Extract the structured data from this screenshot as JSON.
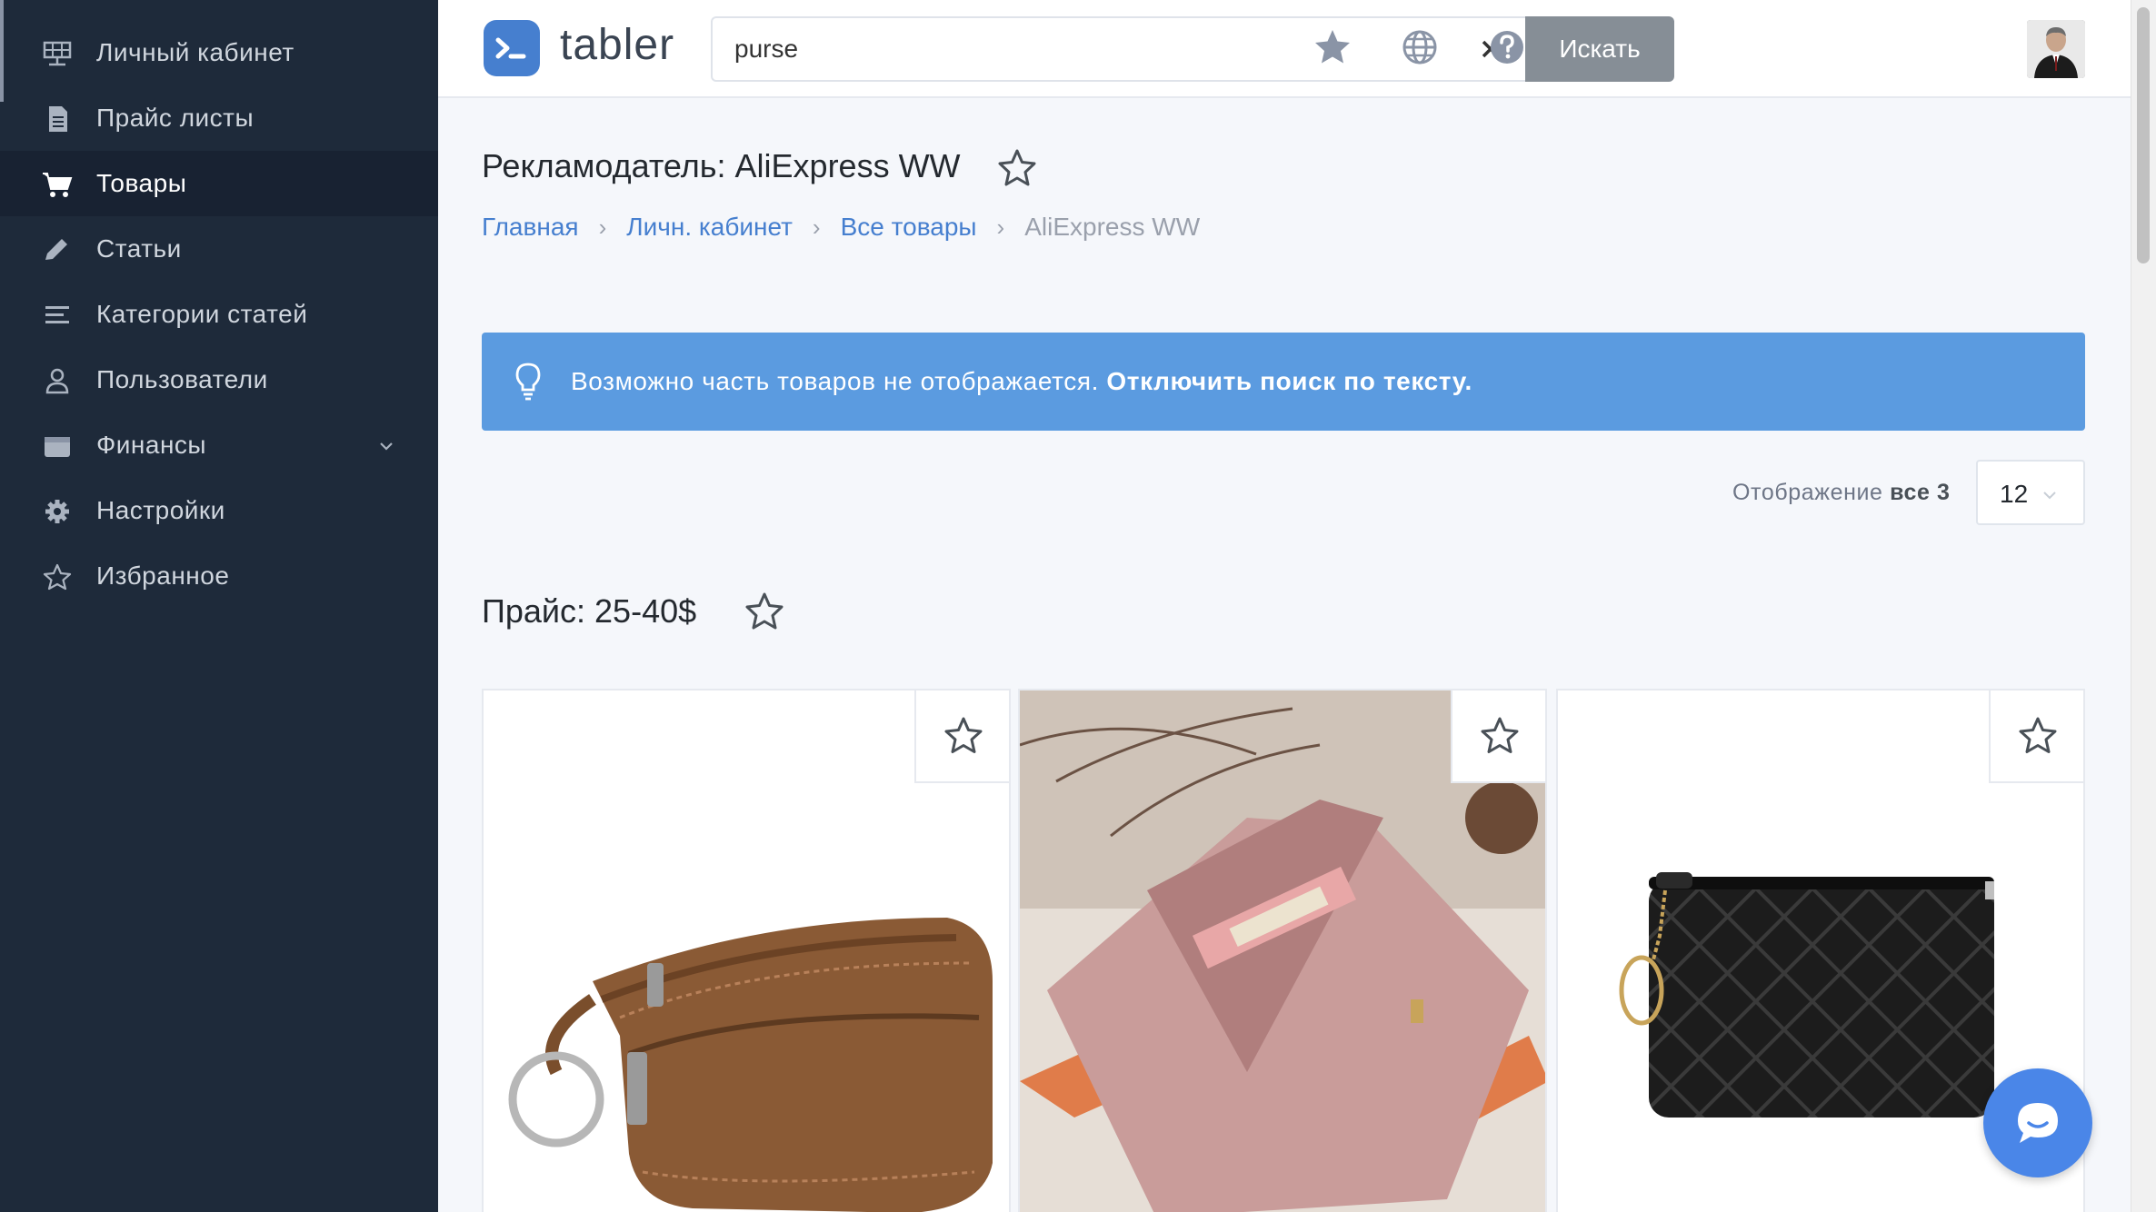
{
  "sidebar": {
    "items": [
      {
        "label": "Личный кабинет",
        "icon": "dashboard-icon",
        "active": false
      },
      {
        "label": "Прайс листы",
        "icon": "document-icon",
        "active": false
      },
      {
        "label": "Товары",
        "icon": "cart-icon",
        "active": true
      },
      {
        "label": "Статьи",
        "icon": "pencil-icon",
        "active": false
      },
      {
        "label": "Категории статей",
        "icon": "list-icon",
        "active": false
      },
      {
        "label": "Пользователи",
        "icon": "user-icon",
        "active": false
      },
      {
        "label": "Финансы",
        "icon": "wallet-icon",
        "active": false,
        "expandable": true
      },
      {
        "label": "Настройки",
        "icon": "gear-icon",
        "active": false
      },
      {
        "label": "Избранное",
        "icon": "star-icon",
        "active": false
      }
    ]
  },
  "header": {
    "logo_text": "tabler",
    "search_value": "purse",
    "search_button": "Искать",
    "icons": [
      "star-icon",
      "globe-icon",
      "help-icon",
      "avatar"
    ]
  },
  "page": {
    "title": "Рекламодатель: AliExpress WW",
    "breadcrumb": [
      "Главная",
      "Личн. кабинет",
      "Все товары",
      "AliExpress WW"
    ]
  },
  "alert": {
    "text": "Возможно часть товаров не отображается.",
    "link": "Отключить поиск по тексту."
  },
  "listing": {
    "display_prefix": "Отображение",
    "display_bold": "все 3",
    "per_page": "12"
  },
  "section": {
    "title": "Прайс: 25-40$"
  },
  "products": [
    {
      "name": "brown-leather-coin-purse"
    },
    {
      "name": "pink-wallet"
    },
    {
      "name": "black-quilted-purse"
    }
  ],
  "colors": {
    "sidebar_bg": "#1e2a3a",
    "accent": "#467fcf",
    "alert_bg": "#5b9be0",
    "search_button_bg": "#868e96"
  }
}
